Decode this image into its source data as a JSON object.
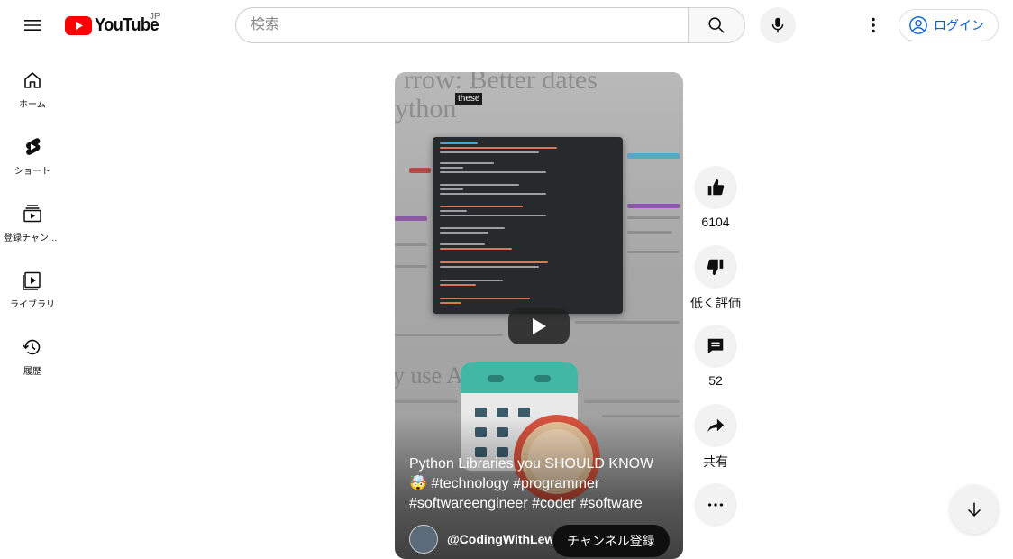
{
  "header": {
    "logo_text": "YouTube",
    "region": "JP",
    "search_placeholder": "検索",
    "login_label": "ログイン"
  },
  "sidebar": {
    "items": [
      {
        "label": "ホーム",
        "icon": "home-icon"
      },
      {
        "label": "ショート",
        "icon": "shorts-icon"
      },
      {
        "label": "登録チャンネル",
        "icon": "subscriptions-icon"
      },
      {
        "label": "ライブラリ",
        "icon": "library-icon"
      },
      {
        "label": "履歴",
        "icon": "history-icon"
      }
    ]
  },
  "short": {
    "video_text": {
      "headline_top": "rrow: Better dates",
      "headline_sub": "ython",
      "headline_bottom": "y use A     uilt-in mod",
      "caption": "these"
    },
    "title": "Python Libraries you SHOULD KNOW 🤯 #technology #programmer #softwareengineer #coder #software",
    "channel": "@CodingWithLewis",
    "subscribe_label": "チャンネル登録"
  },
  "actions": {
    "like_count": "6104",
    "dislike_label": "低く評価",
    "comment_count": "52",
    "share_label": "共有"
  },
  "colors": {
    "brand_red": "#ff0000",
    "link_blue": "#065fd4"
  }
}
